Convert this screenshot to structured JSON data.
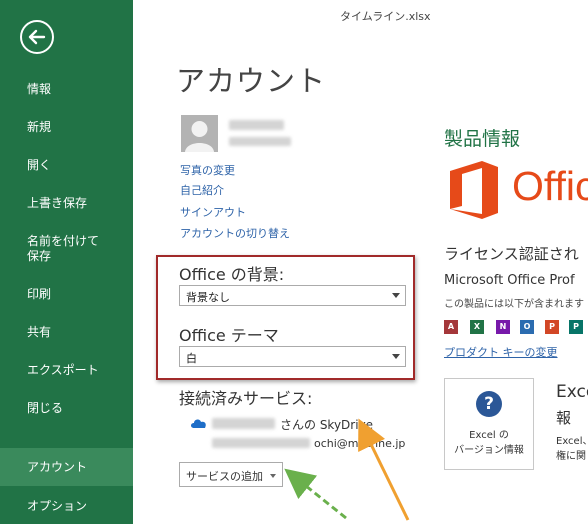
{
  "window": {
    "filename": "タイムライン.xlsx"
  },
  "sidebar": {
    "items": [
      {
        "label": "情報"
      },
      {
        "label": "新規"
      },
      {
        "label": "開く"
      },
      {
        "label": "上書き保存"
      },
      {
        "label": "名前を付けて"
      },
      {
        "label": "保存"
      },
      {
        "label": "印刷"
      },
      {
        "label": "共有"
      },
      {
        "label": "エクスポート"
      },
      {
        "label": "閉じる"
      },
      {
        "label": "アカウント"
      },
      {
        "label": "オプション"
      }
    ],
    "active": "アカウント",
    "back_icon": "back-arrow-icon",
    "colors": {
      "background": "#217346",
      "active": "#3a8a5c"
    }
  },
  "account": {
    "title": "アカウント",
    "user_links": [
      "写真の変更",
      "自己紹介",
      "サインアウト",
      "アカウントの切り替え"
    ],
    "background": {
      "label": "Office の背景:",
      "value": "背景なし"
    },
    "theme": {
      "label": "Office テーマ",
      "value": "白"
    },
    "services": {
      "label": "接続済みサービス:",
      "user_suffix": "さんの SkyDrive",
      "email_visible": "ochi@m.jcnne.jp",
      "add_button": "サービスの追加"
    }
  },
  "product": {
    "title": "製品情報",
    "logo_text": "Offic",
    "license_title": "ライセンス認証され",
    "license_product": "Microsoft Office Prof",
    "license_note": "この製品には以下が含まれます",
    "change_key": "プロダクト キーの変更",
    "apps": [
      {
        "letter": "A",
        "color": "#a4373a"
      },
      {
        "letter": "X",
        "color": "#217346"
      },
      {
        "letter": "N",
        "color": "#7719aa"
      },
      {
        "letter": "O",
        "color": "#2b6cb0"
      },
      {
        "letter": "P",
        "color": "#d24726"
      },
      {
        "letter": "P",
        "color": "#077568"
      }
    ],
    "about": {
      "button_line1": "Excel の",
      "button_line2": "バージョン情報",
      "heading1": "Excel",
      "heading2": "報",
      "desc1": "Excel、",
      "desc2": "権に関"
    }
  },
  "colors": {
    "accent_green": "#217346",
    "link_blue": "#2e63a8",
    "office_orange": "#e64a19",
    "highlight_red": "#a12a2a",
    "arrow_orange": "#f0a030",
    "arrow_green": "#6ab04c"
  }
}
